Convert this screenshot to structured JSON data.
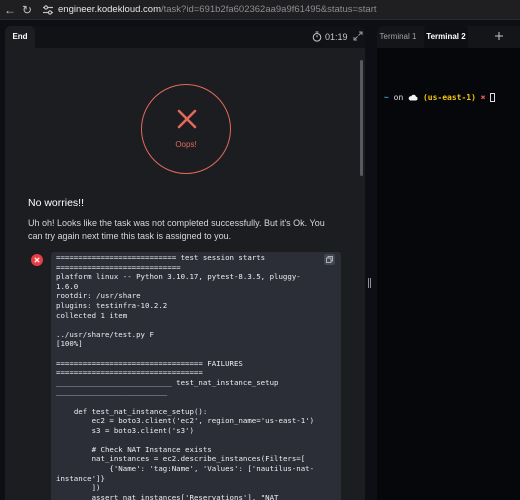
{
  "browser": {
    "url_host": "engineer.kodekloud.com",
    "url_path": "/task?id=691b2fa602362aa9a9f61495&status=start"
  },
  "left_panel": {
    "tab_label": "End",
    "timer": "01:19"
  },
  "result": {
    "badge_text": "Oops!",
    "heading": "No worries!!",
    "message": "Uh oh! Looks like the task was not completed successfully. But it's Ok. You can try again next time this task is assigned to you.",
    "log": "=========================== test session starts ============================\nplatform linux -- Python 3.10.17, pytest-8.3.5, pluggy-1.6.0\nrootdir: /usr/share\nplugins: testinfra-10.2.2\ncollected 1 item\n\n../usr/share/test.py F\n[100%]\n\n================================= FAILURES =================================\n__________________________ test_nat_instance_setup _________________________\n\n    def test_nat_instance_setup():\n        ec2 = boto3.client('ec2', region_name='us-east-1')\n        s3 = boto3.client('s3')\n\n        # Check NAT Instance exists\n        nat_instances = ec2.describe_instances(Filters=[\n            {'Name': 'tag:Name', 'Values': ['nautilus-nat-instance']}\n        ])\n        assert nat_instances['Reservations'], \"NAT Instance not found.\""
  },
  "terminal": {
    "tabs": [
      "Terminal 1",
      "Terminal 2"
    ],
    "active_tab": "Terminal 2",
    "prompt_tilde": "~",
    "prompt_on": "on",
    "prompt_region": "(us-east-1)",
    "prompt_symbol": "✖"
  },
  "colors": {
    "error": "#e2695b",
    "region": "#f1c40f",
    "tilde": "#33b3d6"
  }
}
